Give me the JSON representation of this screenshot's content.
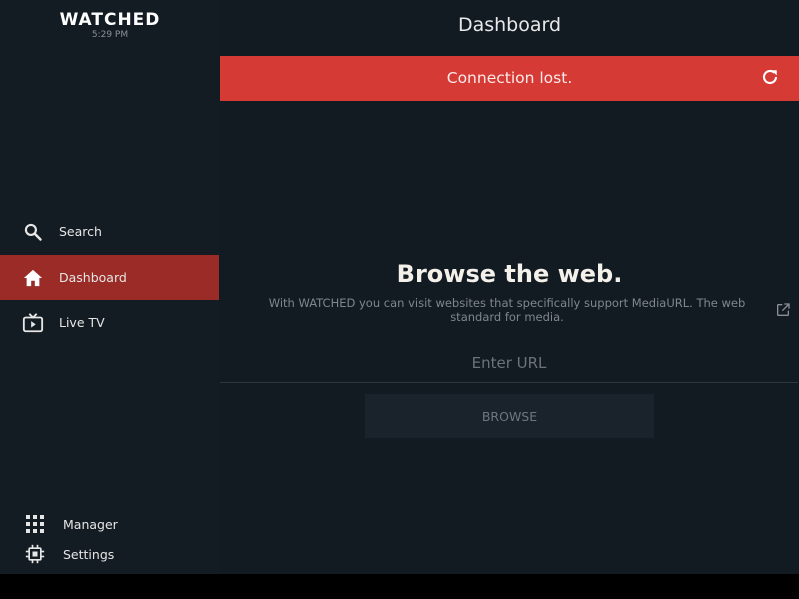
{
  "app": {
    "logo": "WATCHED",
    "clock": "5:29 PM"
  },
  "sidebar": {
    "items": [
      {
        "label": "Search",
        "icon": "search-icon"
      },
      {
        "label": "Dashboard",
        "icon": "home-icon",
        "active": true
      },
      {
        "label": "Live TV",
        "icon": "tv-icon"
      }
    ],
    "bottom_items": [
      {
        "label": "Manager",
        "icon": "grid-icon"
      },
      {
        "label": "Settings",
        "icon": "chip-icon"
      }
    ]
  },
  "main": {
    "title": "Dashboard",
    "banner": {
      "text": "Connection lost.",
      "icon": "refresh-icon"
    },
    "browse": {
      "heading": "Browse the web.",
      "description": "With WATCHED you can visit websites that specifically support MediaURL. The web standard for media.",
      "link_icon": "external-link-icon",
      "url_placeholder": "Enter URL",
      "url_value": "",
      "button_label": "BROWSE"
    }
  },
  "colors": {
    "background": "#131b22",
    "active_item": "#9a2b26",
    "banner": "#d63a35"
  }
}
